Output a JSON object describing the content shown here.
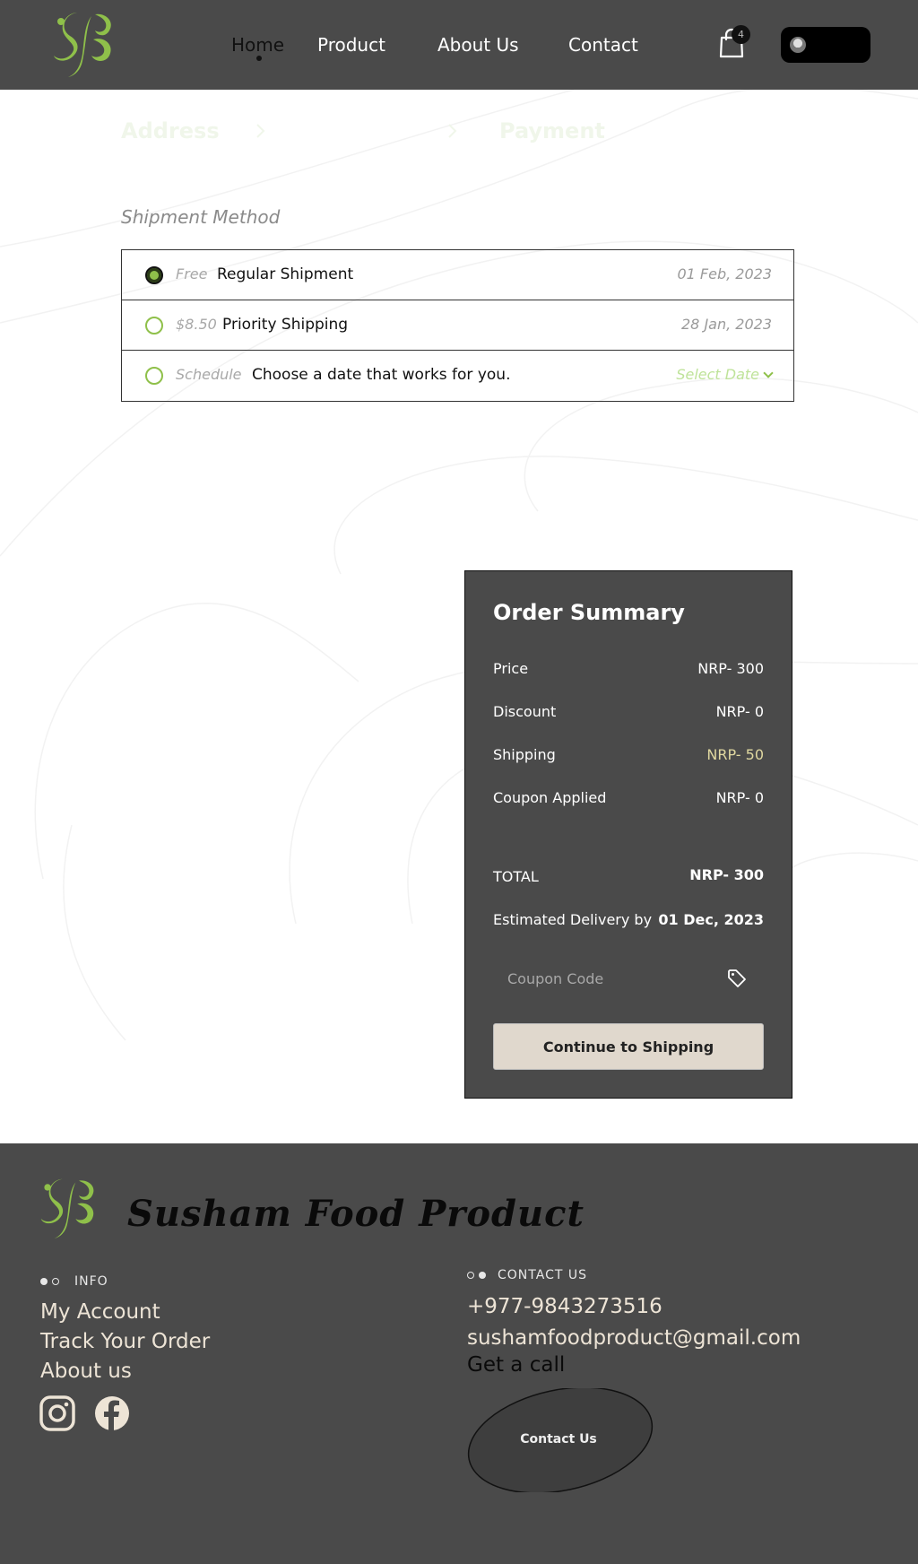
{
  "header": {
    "nav": [
      "Home",
      "Product",
      "About Us",
      "Contact"
    ],
    "active_nav": "Home",
    "cart_count": "4",
    "brand_color": "#8fc04a"
  },
  "steps": {
    "address": "Address",
    "shipping": "",
    "payment": "Payment"
  },
  "shipment": {
    "title": "Shipment Method",
    "options": [
      {
        "tag": "Free",
        "name": "Regular Shipment",
        "date": "01 Feb, 2023",
        "selected": true
      },
      {
        "tag": "$8.50",
        "name": "Priority Shipping",
        "date": "28 Jan, 2023",
        "selected": false
      },
      {
        "tag": "Schedule",
        "name": "Choose a date that works for you.",
        "date": "Select Date",
        "selected": false
      }
    ]
  },
  "summary": {
    "title": "Order Summary",
    "rows": [
      {
        "label": "Price",
        "value": "NRP- 300"
      },
      {
        "label": "Discount",
        "value": "NRP- 0"
      },
      {
        "label": "Shipping",
        "value": "NRP- 50"
      },
      {
        "label": "Coupon Applied",
        "value": "NRP- 0"
      }
    ],
    "total_label": "TOTAL",
    "total_value": "NRP- 300",
    "delivery_label": "Estimated Delivery by",
    "delivery_value": "01 Dec, 2023",
    "coupon_placeholder": "Coupon Code",
    "continue_label": "Continue to Shipping",
    "shipping_color": "#e0d8a0"
  },
  "footer": {
    "brand": "Susham Food Product",
    "info_heading": "INFO",
    "info_links": [
      "My Account",
      "Track Your Order",
      "About us"
    ],
    "contact_heading": "CONTACT US",
    "phone": "+977-9843273516",
    "email": "sushamfoodproduct@gmail.com",
    "call_text": "Get a call",
    "contact_button": "Contact Us",
    "social_icons": [
      "instagram-icon",
      "facebook-icon"
    ]
  }
}
